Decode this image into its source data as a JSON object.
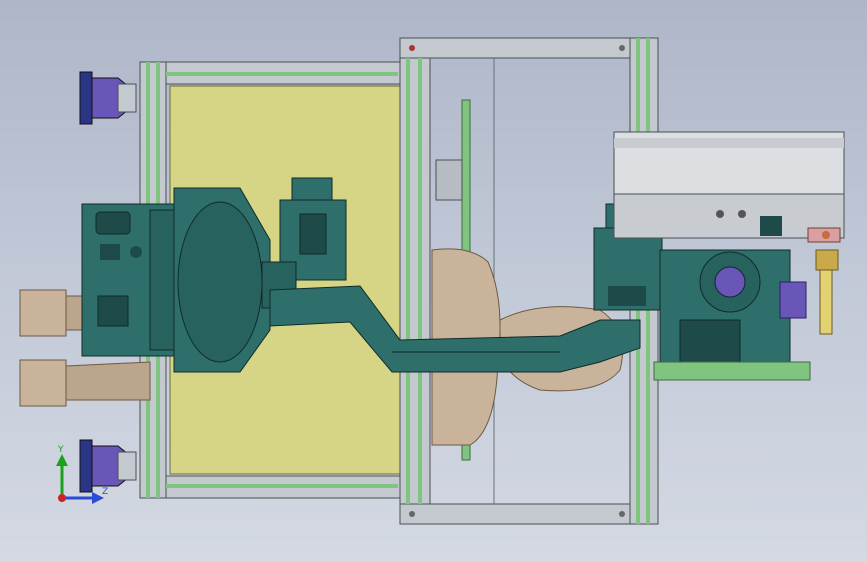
{
  "viewport": {
    "background_top": "#aeb6c8",
    "background_bottom": "#d4d9e3"
  },
  "colors": {
    "frame": "#c4c9cf",
    "frame_edge": "#4a4f55",
    "green_accent": "#7fc57f",
    "yellow_panel": "#d5d585",
    "teal": "#2f6f6b",
    "teal_dark": "#1e4b49",
    "tan": "#c9b49b",
    "navy": "#2a3585",
    "purple": "#6a55b8",
    "copper": "#c96b3c"
  },
  "triad": {
    "y_label": "Y",
    "z_label": "Z",
    "x_color": "#2a4bd6",
    "y_color": "#1aa31a",
    "origin_color": "#cc2222"
  }
}
